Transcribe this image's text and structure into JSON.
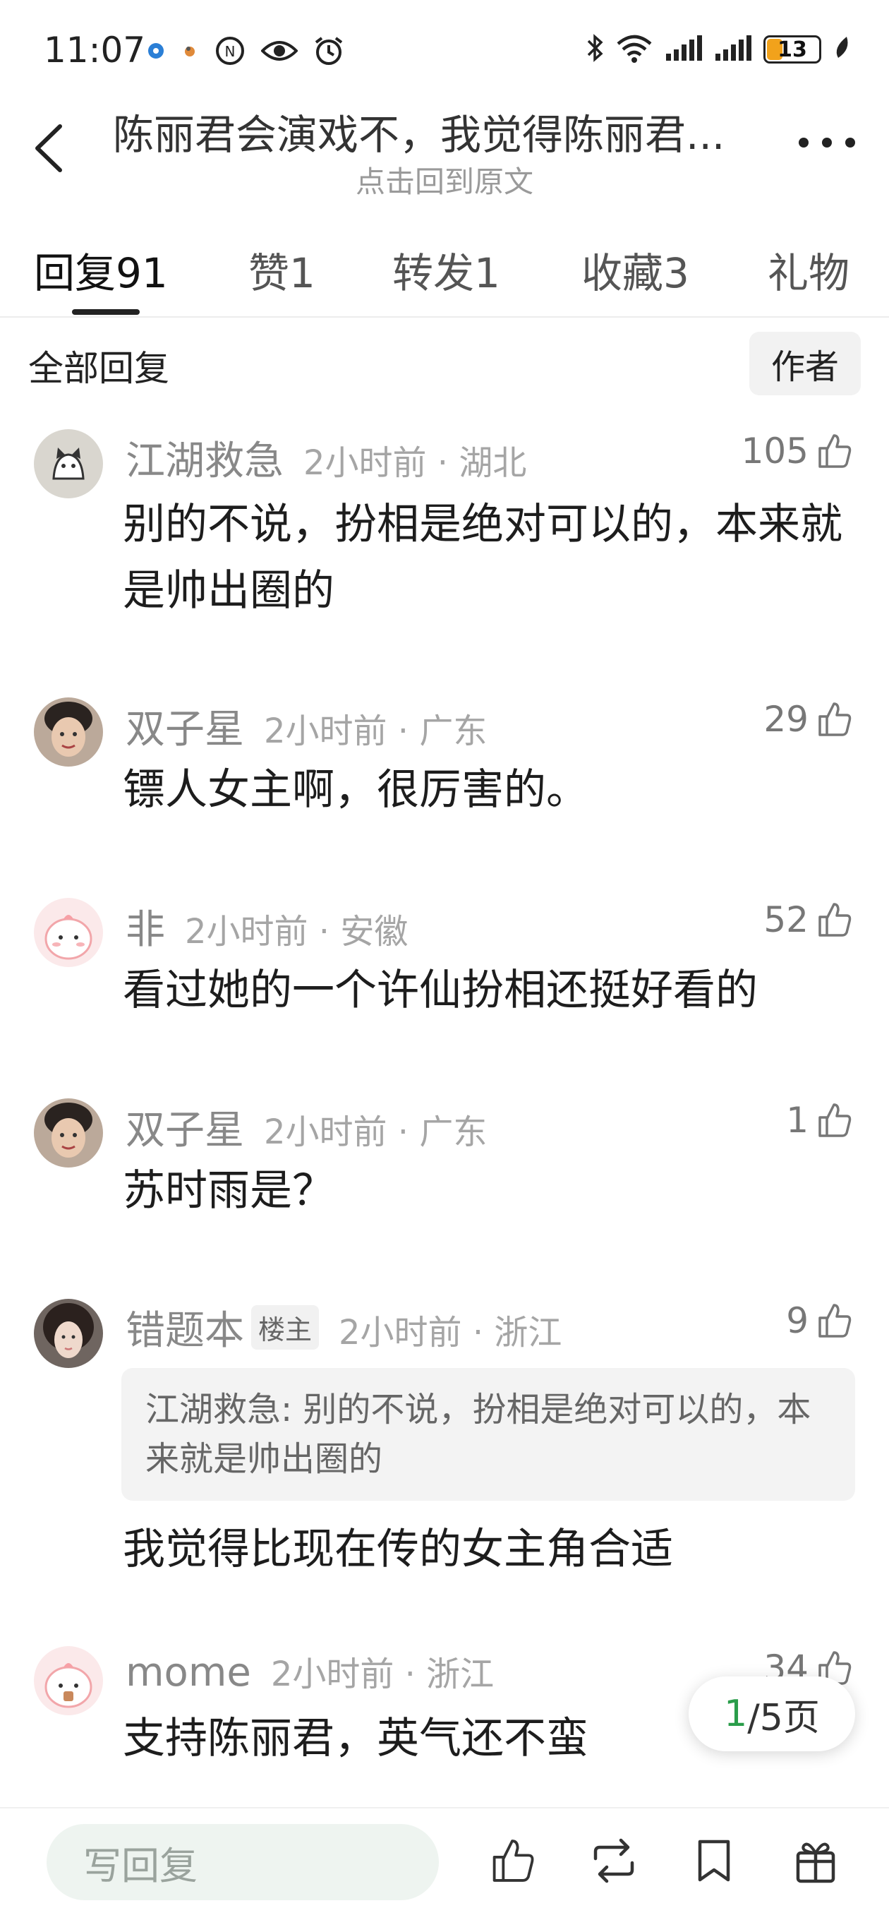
{
  "status_bar": {
    "time": "11:07",
    "battery": "13",
    "battery_level": 0.13,
    "icons": [
      "notification-dot-icon",
      "app-icon",
      "nfc-icon",
      "eye-icon",
      "alarm-icon",
      "bluetooth-icon",
      "wifi-icon",
      "signal-icon",
      "signal-icon",
      "leaf-icon"
    ]
  },
  "header": {
    "title": "陈丽君会演戏不，我觉得陈丽君...",
    "subtitle": "点击回到原文"
  },
  "tabs": [
    {
      "label": "回复",
      "count": "91"
    },
    {
      "label": "赞",
      "count": "1"
    },
    {
      "label": "转发",
      "count": "1"
    },
    {
      "label": "收藏",
      "count": "3"
    },
    {
      "label": "礼物",
      "count": ""
    }
  ],
  "filter": {
    "label": "全部回复",
    "author_button": "作者"
  },
  "comments": [
    {
      "name": "江湖救急",
      "time": "2小时前",
      "location": "湖北",
      "likes": "105",
      "text": "别的不说，扮相是绝对可以的，本来就是帅出圈的"
    },
    {
      "name": "双子星",
      "time": "2小时前",
      "location": "广东",
      "likes": "29",
      "text": "镖人女主啊，很厉害的。"
    },
    {
      "name": "非",
      "time": "2小时前",
      "location": "安徽",
      "likes": "52",
      "text": "看过她的一个许仙扮相还挺好看的"
    },
    {
      "name": "双子星",
      "time": "2小时前",
      "location": "广东",
      "likes": "1",
      "text": "苏时雨是？"
    },
    {
      "name": "错题本",
      "badge": "楼主",
      "time": "2小时前",
      "location": "浙江",
      "likes": "9",
      "quote": "江湖救急: 别的不说，扮相是绝对可以的，本来就是帅出圈的",
      "text": "我觉得比现在传的女主角合适"
    },
    {
      "name": "mome",
      "time": "2小时前",
      "location": "浙江",
      "likes": "34",
      "text": "支持陈丽君，英气还不蛮"
    }
  ],
  "pagination": {
    "current": "1",
    "total_text": "/5页"
  },
  "bottom_bar": {
    "reply_placeholder": "写回复",
    "icons": [
      "like-icon",
      "repost-icon",
      "bookmark-icon",
      "gift-icon"
    ]
  },
  "colors": {
    "accent_green": "#2a9d4a",
    "battery_orange": "#f2a21b"
  }
}
